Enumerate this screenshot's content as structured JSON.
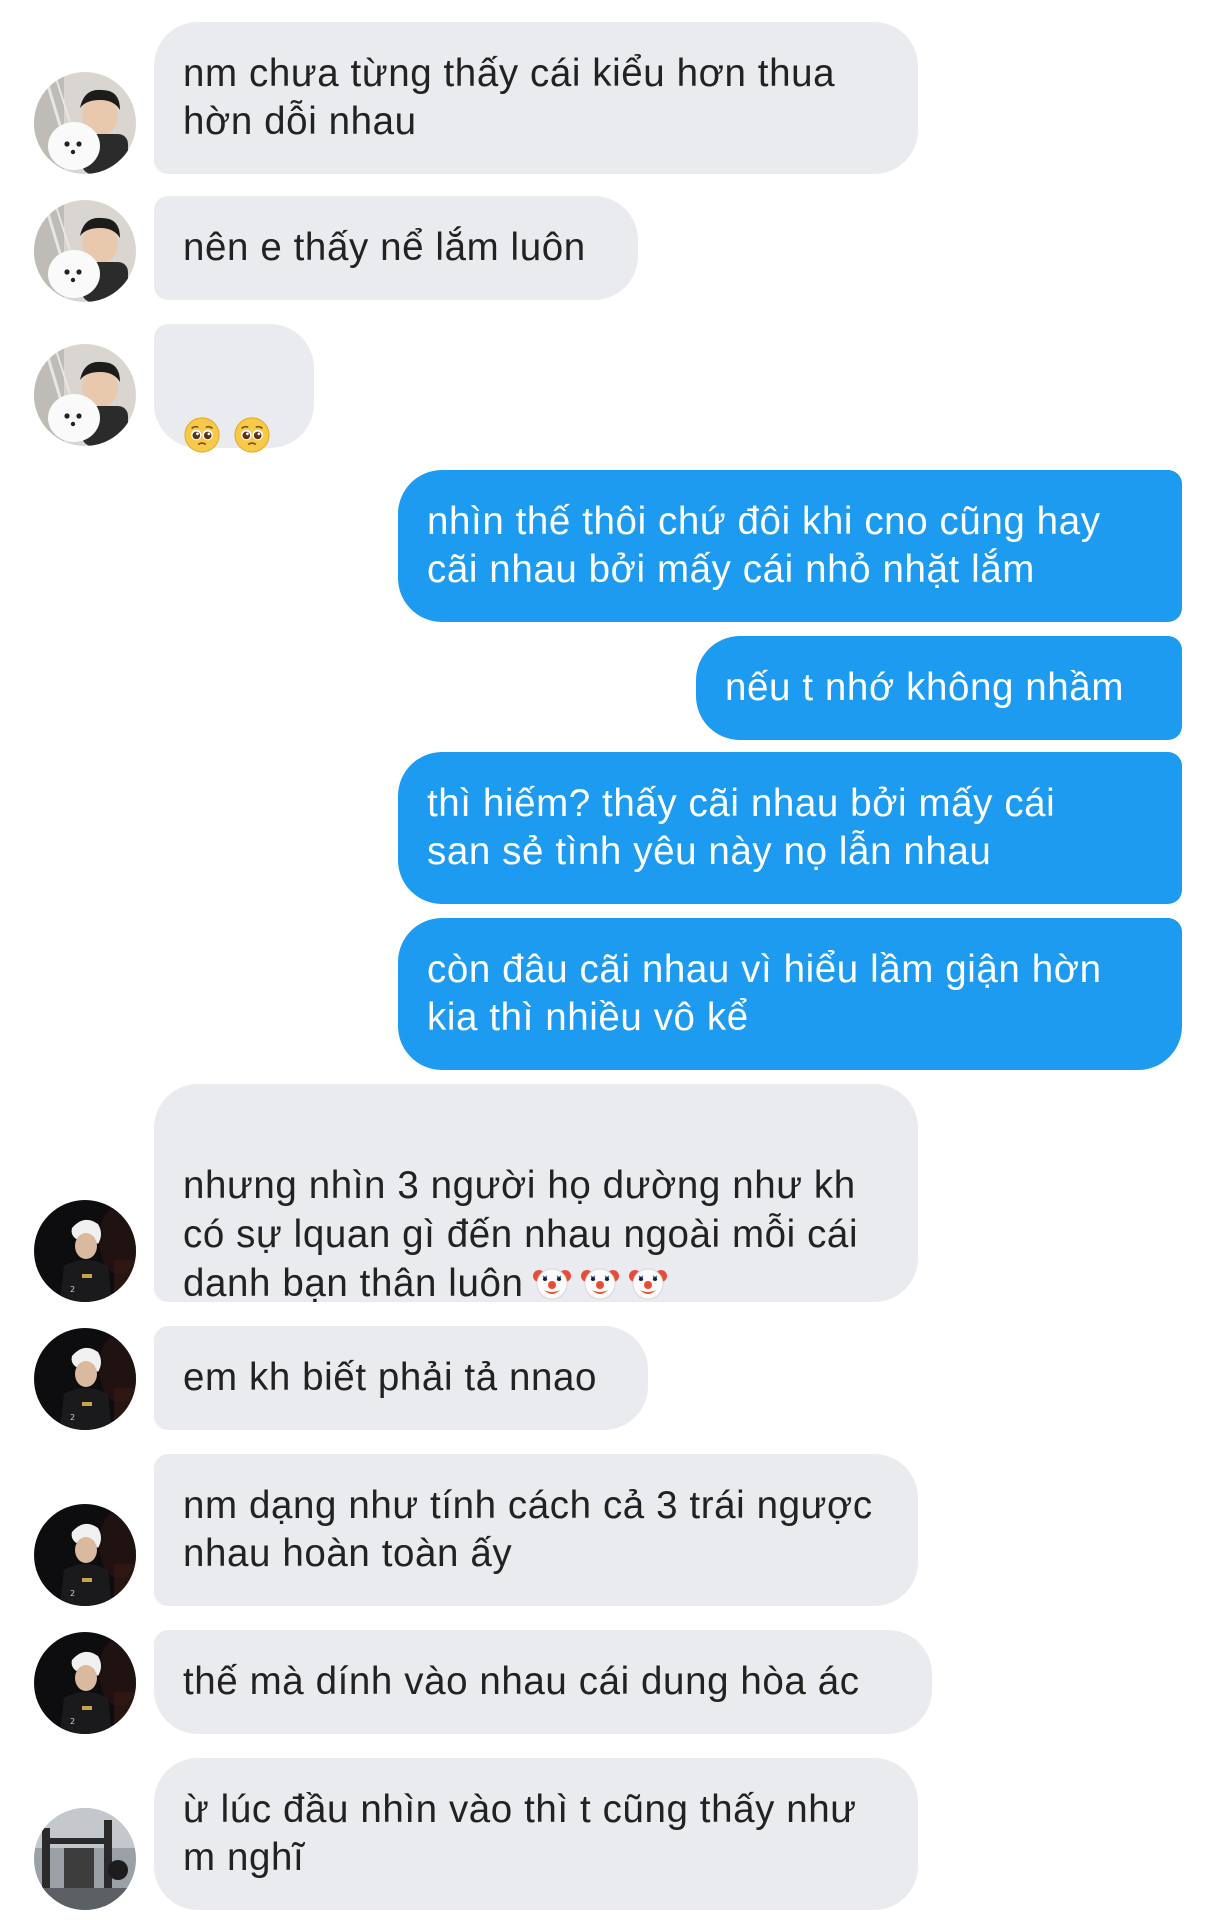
{
  "conversation": {
    "messages": [
      {
        "sender": "other",
        "text": "nm chưa từng thấy cái kiểu hơn thua\nhờn dỗi nhau"
      },
      {
        "sender": "other",
        "text": "nên e thấy nể lắm luôn"
      },
      {
        "sender": "other",
        "emoji": [
          "pleading-face",
          "pleading-face"
        ]
      },
      {
        "sender": "me",
        "text": "nhìn thế thôi chứ đôi khi cno cũng hay\ncãi nhau bởi mấy cái nhỏ nhặt lắm"
      },
      {
        "sender": "me",
        "text": "nếu t nhớ không nhầm"
      },
      {
        "sender": "me",
        "text": "thì hiếm? thấy cãi nhau bởi mấy cái\nsan sẻ tình yêu này nọ lẫn nhau"
      },
      {
        "sender": "me",
        "text": "còn đâu cãi nhau vì hiểu lầm giận hờn\nkia thì nhiều vô kể"
      },
      {
        "sender": "other",
        "text": "nhưng nhìn 3 người họ dường như kh\ncó sự lquan gì đến nhau ngoài mỗi cái\ndanh bạn thân luôn",
        "emoji": [
          "clown-face",
          "clown-face",
          "clown-face"
        ]
      },
      {
        "sender": "other",
        "text": "em kh biết phải tả nnao"
      },
      {
        "sender": "other",
        "text": "nm dạng như tính cách cả 3 trái ngược\nnhau hoàn toàn ấy"
      },
      {
        "sender": "other",
        "text": "thế mà dính vào nhau cái dung hòa ác"
      },
      {
        "sender": "other",
        "text": "ừ lúc đầu nhìn vào thì t cũng thấy như\nm nghĩ"
      }
    ]
  },
  "colors": {
    "incoming_bubble": "#e9ebee",
    "incoming_text": "#222222",
    "outgoing_bubble": "#1d9bf0",
    "outgoing_text": "#ffffff"
  },
  "avatars": [
    "avatar-boy-with-white-dog",
    "avatar-boy-with-white-dog",
    "avatar-boy-with-white-dog",
    "avatar-player-dark",
    "avatar-player-dark",
    "avatar-player-dark",
    "avatar-player-dark",
    "avatar-gym"
  ]
}
